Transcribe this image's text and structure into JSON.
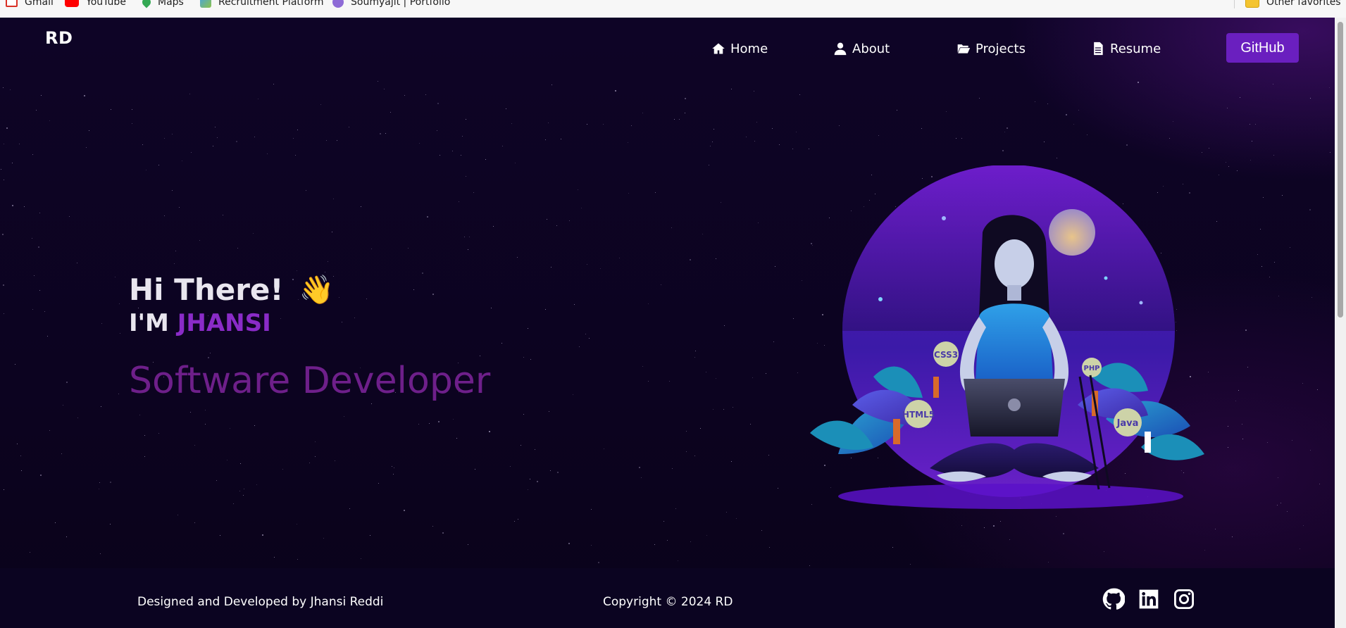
{
  "bookmarks": {
    "items": [
      {
        "label": "Gmail",
        "icon": "gmail-icon"
      },
      {
        "label": "YouTube",
        "icon": "youtube-icon"
      },
      {
        "label": "Maps",
        "icon": "maps-icon"
      },
      {
        "label": "Recruitment Platform",
        "icon": "site-icon"
      },
      {
        "label": "Soumyajit | Portfolio",
        "icon": "site-icon"
      }
    ],
    "other": "Other favorites"
  },
  "nav": {
    "logo": "RD",
    "items": [
      {
        "label": "Home",
        "icon": "home-icon"
      },
      {
        "label": "About",
        "icon": "user-icon"
      },
      {
        "label": "Projects",
        "icon": "folder-open-icon"
      },
      {
        "label": "Resume",
        "icon": "file-icon"
      }
    ],
    "github": "GitHub"
  },
  "hero": {
    "greeting": "Hi There!",
    "wave": "👋",
    "name_prefix": "I'M",
    "name": "JHANSI",
    "role": "Software Developer",
    "badges": [
      "CSS3",
      "PHP",
      "HTML5",
      "Java"
    ]
  },
  "footer": {
    "designed": "Designed and Developed by Jhansi Reddi",
    "copyright": "Copyright © 2024 RD",
    "socials": [
      "github-icon",
      "linkedin-icon",
      "instagram-icon"
    ]
  },
  "colors": {
    "background": "#0c0320",
    "accent": "#6a1fbf",
    "name_highlight": "#8a2bc8",
    "role_text": "#6e1f8a"
  }
}
